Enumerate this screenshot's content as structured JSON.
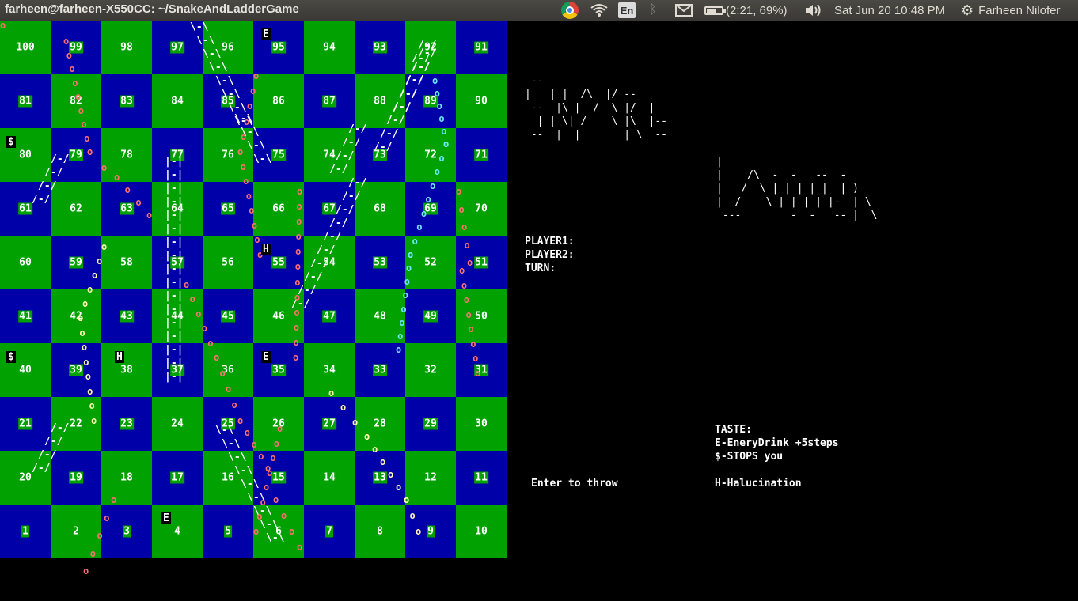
{
  "topbar": {
    "window_title": "farheen@farheen-X550CC: ~/SnakeAndLadderGame",
    "keyboard_layout": "En",
    "battery": "(2:21, 69%)",
    "battery_level": 0.69,
    "clock": "Sat Jun 20 10:48 PM",
    "user": "Farheen Nilofer",
    "icons": [
      "chrome-icon",
      "wifi-icon",
      "bluetooth-icon",
      "mail-icon",
      "battery-icon",
      "volume-icon",
      "gear-icon"
    ]
  },
  "board": {
    "rows": [
      [
        100,
        99,
        98,
        97,
        96,
        95,
        94,
        93,
        92,
        91
      ],
      [
        81,
        82,
        83,
        84,
        85,
        86,
        87,
        88,
        89,
        90
      ],
      [
        80,
        79,
        78,
        77,
        76,
        75,
        74,
        73,
        72,
        71
      ],
      [
        61,
        62,
        63,
        64,
        65,
        66,
        67,
        68,
        69,
        70
      ],
      [
        60,
        59,
        58,
        57,
        56,
        55,
        54,
        53,
        52,
        51
      ],
      [
        41,
        42,
        43,
        44,
        45,
        46,
        47,
        48,
        49,
        50
      ],
      [
        40,
        39,
        38,
        37,
        36,
        35,
        34,
        33,
        32,
        31
      ],
      [
        21,
        22,
        23,
        24,
        25,
        26,
        27,
        28,
        29,
        30
      ],
      [
        20,
        19,
        18,
        17,
        16,
        15,
        14,
        13,
        12,
        11
      ],
      [
        1,
        2,
        3,
        4,
        5,
        6,
        7,
        8,
        9,
        10
      ]
    ],
    "colors": {
      "green": "#00a100",
      "blue": "#0000a8"
    },
    "items": [
      {
        "label": "E",
        "cell": 95
      },
      {
        "label": "$",
        "cell": 80
      },
      {
        "label": "H",
        "cell": 55
      },
      {
        "label": "$",
        "cell": 40
      },
      {
        "label": "H",
        "cell": 38
      },
      {
        "label": "E",
        "cell": 35
      },
      {
        "label": "E",
        "cell": 4
      }
    ]
  },
  "snake_art": " --\n|   | |  /\\  |/ --\n --  |\\ |  /  \\ |/  |\n  | | \\| /    \\ |\\  |--\n --  |  |       | \\  --",
  "ladder_art": "|\n|    /\\  -  -   --  -\n|   /  \\ | | | | |  | )\n|  /    \\ | | | | |-  | \\\n ---        -  -   -- |  \\",
  "status": {
    "player1": "PLAYER1:",
    "player2": "PLAYER2:",
    "turn": "TURN:",
    "prompt": "Enter to throw"
  },
  "legend": {
    "title": "TASTE:",
    "items": [
      "E-EneryDrink +5steps",
      "$-STOPS you",
      "H-Halucination"
    ]
  }
}
